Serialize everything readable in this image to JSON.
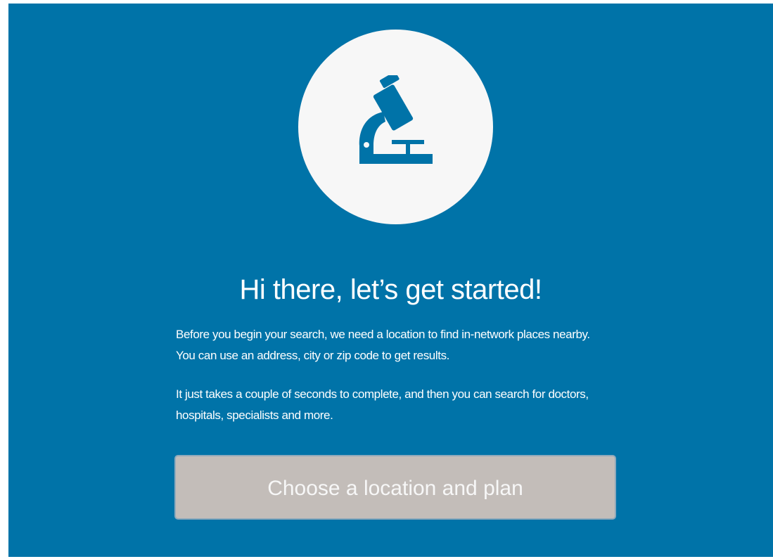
{
  "colors": {
    "panel_background": "#0073A8",
    "circle_background": "#F7F7F7",
    "icon_color": "#0073A8",
    "text_color": "#FFFFFF",
    "button_background": "#C3BDB9",
    "button_text": "#F7F7F7"
  },
  "hero": {
    "icon": "microscope-icon"
  },
  "intro": {
    "title": "Hi there, let’s get started!",
    "paragraph_1": "Before you begin your search, we need a location to find in-network places nearby. You can use an address, city or zip code to get results.",
    "paragraph_2": "It just takes a couple of seconds to complete, and then you can search for doctors, hospitals, specialists and more."
  },
  "cta": {
    "label": "Choose a location and plan"
  }
}
